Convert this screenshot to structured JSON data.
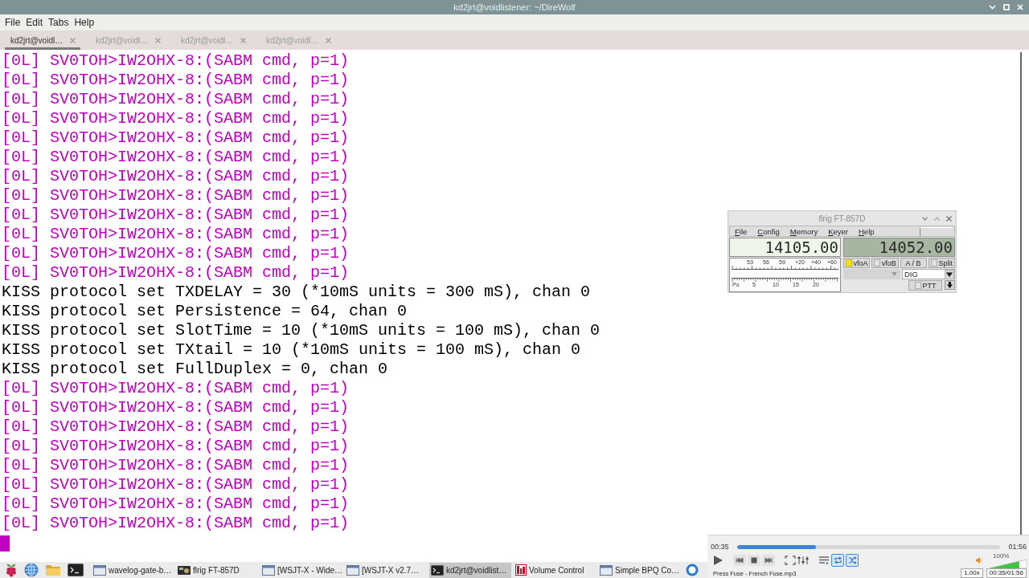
{
  "window": {
    "title": "kd2jrt@voidlistener: ~/DireWolf"
  },
  "menu": [
    "File",
    "Edit",
    "Tabs",
    "Help"
  ],
  "tabs": [
    {
      "label": "kd2jrt@voidl…",
      "selected": true
    },
    {
      "label": "kd2jrt@voidl…",
      "selected": false
    },
    {
      "label": "kd2jrt@voidl…",
      "selected": false
    },
    {
      "label": "kd2jrt@voidl…",
      "selected": false
    }
  ],
  "terminal": {
    "lines": [
      {
        "text": "[0L] SV0TOH>IW2OHX-8:(SABM cmd, p=1)",
        "color": "#c000c0"
      },
      {
        "text": "[0L] SV0TOH>IW2OHX-8:(SABM cmd, p=1)",
        "color": "#c000c0"
      },
      {
        "text": "[0L] SV0TOH>IW2OHX-8:(SABM cmd, p=1)",
        "color": "#c000c0"
      },
      {
        "text": "[0L] SV0TOH>IW2OHX-8:(SABM cmd, p=1)",
        "color": "#c000c0"
      },
      {
        "text": "[0L] SV0TOH>IW2OHX-8:(SABM cmd, p=1)",
        "color": "#c000c0"
      },
      {
        "text": "[0L] SV0TOH>IW2OHX-8:(SABM cmd, p=1)",
        "color": "#c000c0"
      },
      {
        "text": "[0L] SV0TOH>IW2OHX-8:(SABM cmd, p=1)",
        "color": "#c000c0"
      },
      {
        "text": "[0L] SV0TOH>IW2OHX-8:(SABM cmd, p=1)",
        "color": "#c000c0"
      },
      {
        "text": "[0L] SV0TOH>IW2OHX-8:(SABM cmd, p=1)",
        "color": "#c000c0"
      },
      {
        "text": "[0L] SV0TOH>IW2OHX-8:(SABM cmd, p=1)",
        "color": "#c000c0"
      },
      {
        "text": "[0L] SV0TOH>IW2OHX-8:(SABM cmd, p=1)",
        "color": "#c000c0"
      },
      {
        "text": "[0L] SV0TOH>IW2OHX-8:(SABM cmd, p=1)",
        "color": "#c000c0"
      },
      {
        "text": "KISS protocol set TXDELAY = 30 (*10mS units = 300 mS), chan 0",
        "color": "#000000"
      },
      {
        "text": "KISS protocol set Persistence = 64, chan 0",
        "color": "#000000"
      },
      {
        "text": "KISS protocol set SlotTime = 10 (*10mS units = 100 mS), chan 0",
        "color": "#000000"
      },
      {
        "text": "KISS protocol set TXtail = 10 (*10mS units = 100 mS), chan 0",
        "color": "#000000"
      },
      {
        "text": "KISS protocol set FullDuplex = 0, chan 0",
        "color": "#000000"
      },
      {
        "text": "[0L] SV0TOH>IW2OHX-8:(SABM cmd, p=1)",
        "color": "#c000c0"
      },
      {
        "text": "[0L] SV0TOH>IW2OHX-8:(SABM cmd, p=1)",
        "color": "#c000c0"
      },
      {
        "text": "[0L] SV0TOH>IW2OHX-8:(SABM cmd, p=1)",
        "color": "#c000c0"
      },
      {
        "text": "[0L] SV0TOH>IW2OHX-8:(SABM cmd, p=1)",
        "color": "#c000c0"
      },
      {
        "text": "[0L] SV0TOH>IW2OHX-8:(SABM cmd, p=1)",
        "color": "#c000c0"
      },
      {
        "text": "[0L] SV0TOH>IW2OHX-8:(SABM cmd, p=1)",
        "color": "#c000c0"
      },
      {
        "text": "[0L] SV0TOH>IW2OHX-8:(SABM cmd, p=1)",
        "color": "#c000c0"
      },
      {
        "text": "[0L] SV0TOH>IW2OHX-8:(SABM cmd, p=1)",
        "color": "#c000c0"
      }
    ],
    "cursor": true
  },
  "flrig": {
    "title": "flrig FT-857D",
    "menu": [
      "File",
      "Config",
      "Memory",
      "Keyer",
      "Help"
    ],
    "displays": [
      {
        "value": "14105.00",
        "selected": true
      },
      {
        "value": "14052.00",
        "selected": false
      }
    ],
    "meter": {
      "upper_scale": [
        "53",
        "56",
        "59",
        "+20",
        "+40",
        "+60"
      ],
      "lower_scale": [
        "Po",
        "5",
        "10",
        "15",
        "20"
      ]
    },
    "buttons": [
      {
        "label": "vfoA",
        "kind": "toggle",
        "on": true
      },
      {
        "label": "vfoB",
        "kind": "toggle",
        "on": false
      },
      {
        "label": "A / B",
        "kind": "push"
      },
      {
        "label": "Split",
        "kind": "toggle",
        "on": false
      }
    ],
    "mode": "DIG",
    "ptt": {
      "label": "PTT",
      "on": false
    }
  },
  "player": {
    "elapsed": "00:35",
    "total": "01:56",
    "progress": {
      "level": 0.3
    },
    "toggles": [
      {
        "kind": "loop",
        "on": true
      },
      {
        "kind": "shuffle",
        "on": true
      }
    ],
    "volume": {
      "level": 0.8,
      "reading": "100%"
    },
    "track": "Press Fuse - French Fuse.mp3",
    "speed": "1.00x",
    "time": "00:35/01:56"
  },
  "taskbar": {
    "tasks": [
      {
        "label": "wavelog-gate-b…",
        "kind": "window",
        "selected": false
      },
      {
        "label": "flrig FT-857D",
        "kind": "radio",
        "selected": false
      },
      {
        "label": "[WSJT-X - Wide…",
        "kind": "window",
        "selected": false
      },
      {
        "label": "[WSJT-X v2.7…",
        "kind": "window",
        "selected": false
      },
      {
        "label": "kd2jrt@voidlist…",
        "kind": "terminal",
        "selected": true
      },
      {
        "label": "Volume Control",
        "kind": "mixer",
        "selected": false
      },
      {
        "label": "Simple BPQ Co…",
        "kind": "window",
        "selected": false
      }
    ]
  }
}
